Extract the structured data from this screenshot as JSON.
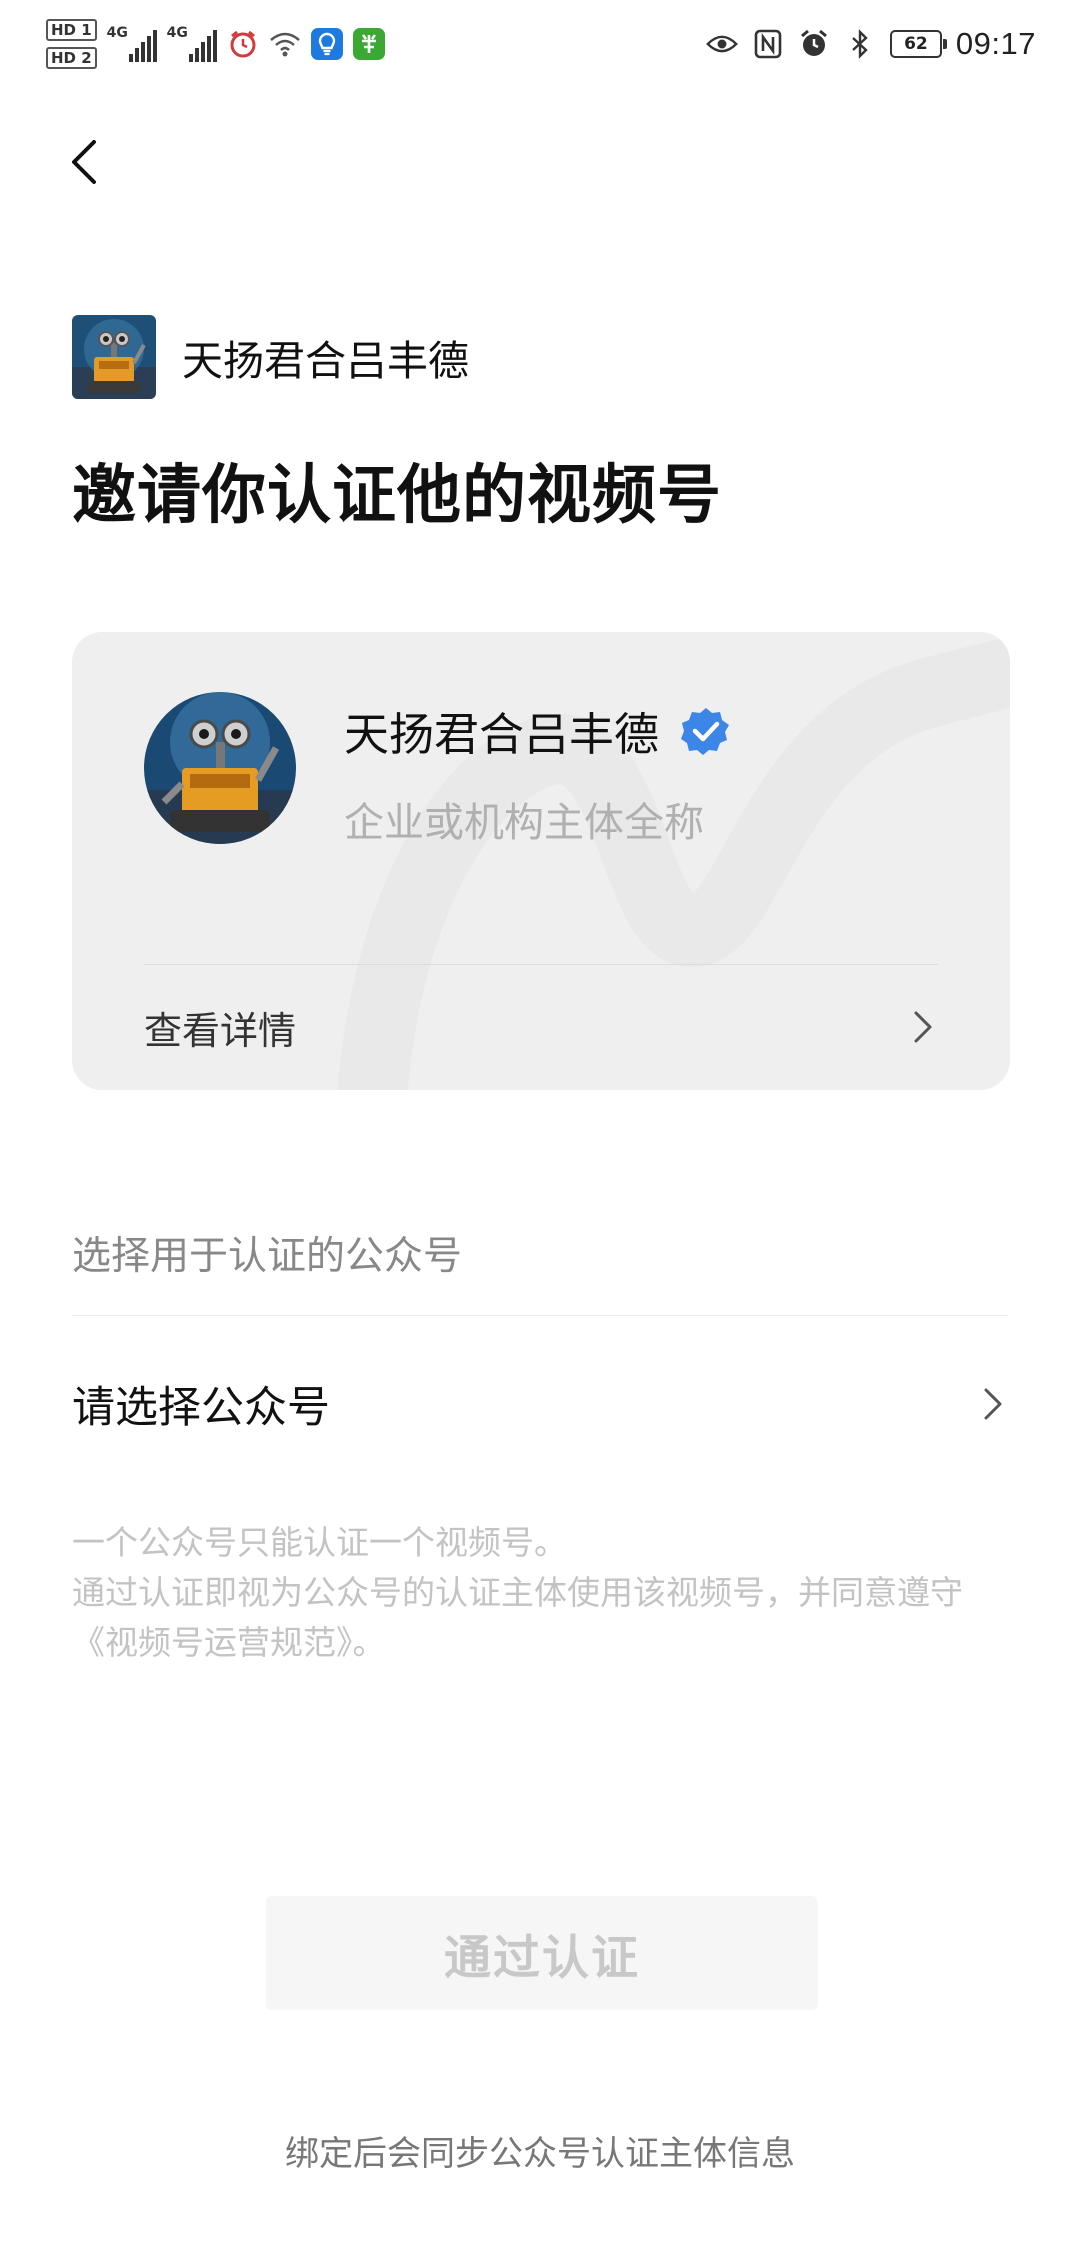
{
  "status_bar": {
    "hd1": "HD 1",
    "hd2": "HD 2",
    "net1": "4G",
    "net2": "4G",
    "battery": "62",
    "time": "09:17"
  },
  "nav": {
    "back_icon": "chevron-left-icon"
  },
  "inviter": {
    "name": "天扬君合吕丰德"
  },
  "page_title": "邀请你认证他的视频号",
  "channel_card": {
    "name": "天扬君合吕丰德",
    "subtitle": "企业或机构主体全称",
    "detail_label": "查看详情"
  },
  "section_label": "选择用于认证的公众号",
  "select_placeholder": "请选择公众号",
  "notes": [
    "一个公众号只能认证一个视频号。",
    "通过认证即视为公众号的认证主体使用该视频号，并同意遵守《视频号运营规范》。"
  ],
  "confirm_button": "通过认证",
  "footer_text": "绑定后会同步公众号认证主体信息",
  "colors": {
    "verified_badge": "#3b86e6",
    "card_background": "#efefef",
    "button_background": "#f6f6f6",
    "button_text_disabled": "#c8c8c8"
  }
}
